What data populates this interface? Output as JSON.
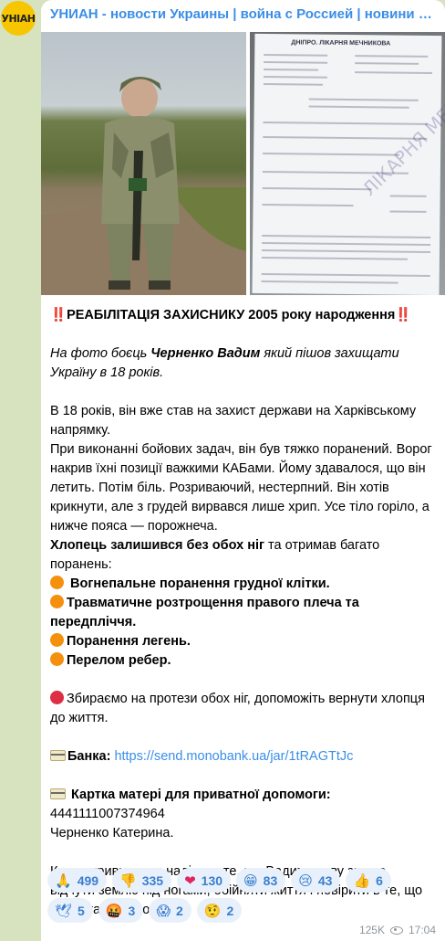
{
  "channel": {
    "avatar_text": "УНІАН",
    "title": "УНИАН - новости Украины | война с Россией | новини України | війна з Росією"
  },
  "media": {
    "left_photo_icon": "soldier-photo",
    "right_photo_icon": "medical-document-photo",
    "doc_header": "ДНІПРО. ЛІКАРНЯ МЕЧНИКОВА",
    "doc_stamp": "ЛІКАРНЯ МЕЧНИКОВА"
  },
  "post": {
    "headline_prefix": "‼️",
    "headline": "РЕАБІЛІТАЦІЯ ЗАХИСНИКУ 2005 року народження",
    "headline_suffix": "‼️",
    "intro_a": "На фото боєць ",
    "intro_name": "Черненко Вадим",
    "intro_b": " який пішов захищати Україну в 18 років.",
    "story": "В 18 років, він вже став на захист держави на Харківському напрямку.",
    "story2": "При виконанні бойових задач, він був тяжко поранений. Ворог накрив їхні позиції важкими КАБами. Йому здавалося, що він летить. Потім біль. Розриваючий, нестерпний. Він хотів крикнути, але з грудей вирвався лише хрип. Усе тіло горіло, а нижче пояса — порожнеча.",
    "legs_bold": "Хлопець залишився без обох ніг",
    "legs_rest": " та отримав багато поранень:",
    "injuries": [
      "Вогнепальне поранення грудної клітки.",
      "Травматичне розтрощення правого плеча та передпліччя.",
      "Поранення легень.",
      "Перелом ребер."
    ],
    "appeal": "Збираємо на протези обох ніг, допоможіть вернути хлопця до життя.",
    "bank_label": "Банка:",
    "bank_link": "https://send.monobank.ua/jar/1tRAGTtJc",
    "card_label": "Картка матері для приватної допомоги:",
    "card_number": " 4441111007374964",
    "card_owner": "Черненко Катерина.",
    "closing": "Кожна гривня, дає надію на те, що Вадим знову зможе відчути землю під ногами, обійняти життя і повірити в те, що доброта переможе",
    "closing_emoji": "🙏"
  },
  "reactions": [
    {
      "emoji": "🙏",
      "count": "499",
      "icon": "pray-icon"
    },
    {
      "emoji": "👎",
      "count": "335",
      "icon": "thumbs-down-icon"
    },
    {
      "emoji": "❤",
      "count": "130",
      "icon": "heart-icon"
    },
    {
      "emoji": "😁",
      "count": "83",
      "icon": "grin-icon"
    },
    {
      "emoji": "😢",
      "count": "43",
      "icon": "cry-icon"
    },
    {
      "emoji": "👍",
      "count": "6",
      "icon": "thumbs-up-icon"
    },
    {
      "emoji": "🕊",
      "count": "5",
      "icon": "dove-icon"
    },
    {
      "emoji": "🤬",
      "count": "3",
      "icon": "angry-icon"
    },
    {
      "emoji": "😱",
      "count": "2",
      "icon": "scream-icon"
    },
    {
      "emoji": "🤨",
      "count": "2",
      "icon": "raised-eyebrow-icon"
    }
  ],
  "meta": {
    "views": "125K",
    "time": "17:04"
  },
  "colors": {
    "accent": "#3a8ee6",
    "background": "#d7e2bf",
    "reaction_bg": "#e8f1fb"
  }
}
